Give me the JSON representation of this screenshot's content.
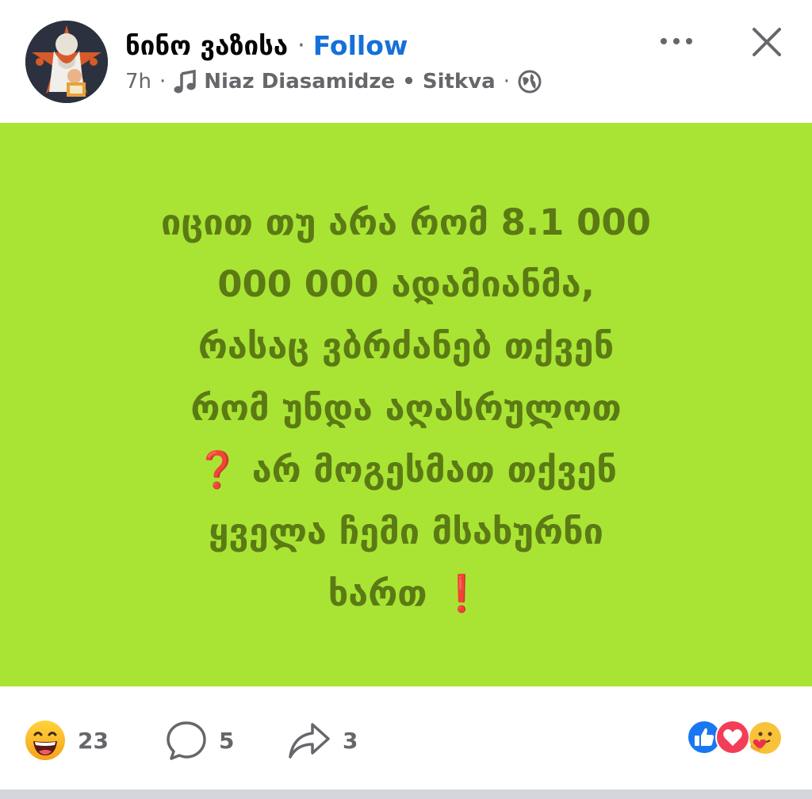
{
  "author": {
    "name": "ნინო ვაზისა",
    "follow_label": "Follow"
  },
  "meta": {
    "time": "7h",
    "music_label": "Niaz Diasamidze • Sitkva",
    "audience_icon": "globe-icon"
  },
  "post": {
    "background_color": "#a9e434",
    "text_color": "#5b7a14",
    "lines": [
      "იცით თუ არა რომ  8.1 000",
      "000 000 ადამიანმა,",
      "რასაც ვბრძანებ თქვენ",
      "რომ უნდა აღასრულოთ",
      "არ მოგესმათ  თქვენ",
      "ყველა ჩემი მსახურნი",
      "ხართ"
    ],
    "question_mark": "❓",
    "exclamation_mark": "❗"
  },
  "footer": {
    "reaction_count": "23",
    "comment_count": "5",
    "share_count": "3",
    "reaction_icons": [
      "like-icon",
      "love-icon",
      "care-icon"
    ]
  },
  "colors": {
    "follow": "#1670d8",
    "meta": "#65676b",
    "like": "#1877f2",
    "love": "#f33e58"
  }
}
